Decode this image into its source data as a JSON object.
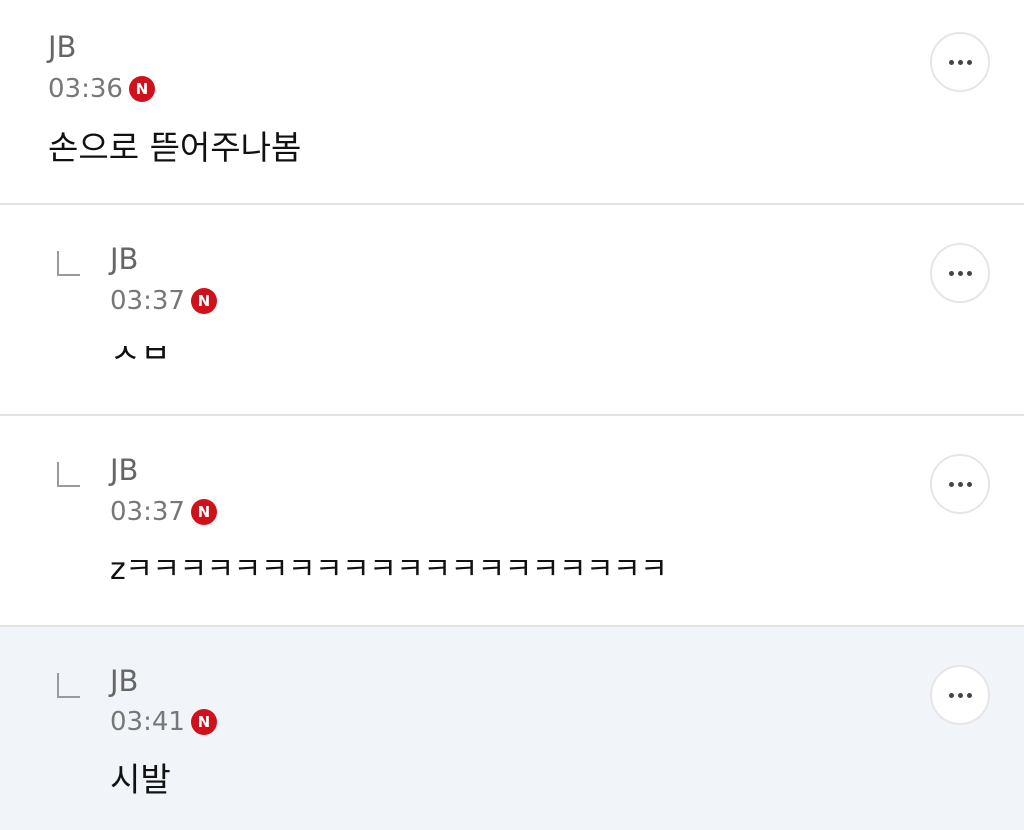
{
  "comments": [
    {
      "author": "JB",
      "time": "03:36",
      "badge": "N",
      "text": "손으로 뜯어주나봄",
      "is_reply": false
    },
    {
      "author": "JB",
      "time": "03:37",
      "badge": "N",
      "text": "ㅅㅂ",
      "is_reply": true
    },
    {
      "author": "JB",
      "time": "03:37",
      "badge": "N",
      "text": "zㅋㅋㅋㅋㅋㅋㅋㅋㅋㅋㅋㅋㅋㅋㅋㅋㅋㅋㅋㅋ",
      "is_reply": true
    },
    {
      "author": "JB",
      "time": "03:41",
      "badge": "N",
      "text": "시발",
      "is_reply": true,
      "highlighted": true
    }
  ],
  "colors": {
    "badge": "#d0101a",
    "highlight_bg": "#f1f5f9",
    "divider": "#e2e2e2"
  },
  "icons": {
    "reply": "reply-corner-icon",
    "more": "more-dots-icon",
    "badge": "naver-n-icon"
  }
}
